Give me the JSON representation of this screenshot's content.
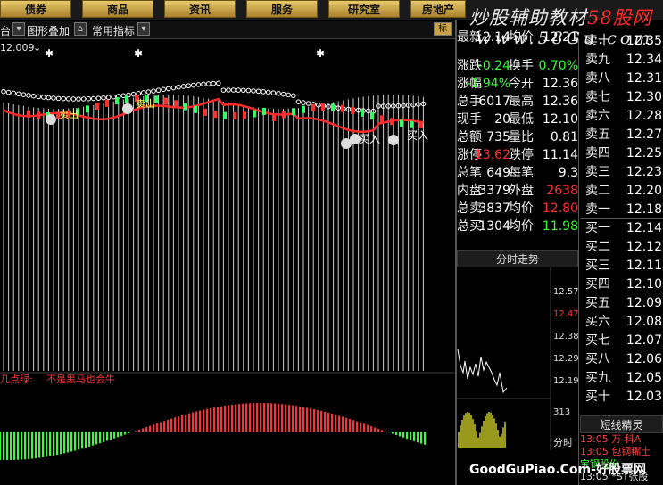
{
  "tabs": [
    "债券",
    "商品",
    "资讯",
    "服务",
    "研究室",
    "房地产"
  ],
  "toolbar": {
    "cut_left": "台",
    "overlay_label": "图形叠加",
    "indicator_label": "常用指标",
    "right_label": "标"
  },
  "watermark": {
    "line1_a": "炒股辅助教材",
    "line1_b": "58股网",
    "line2": "www.58Gu.com"
  },
  "main": {
    "price_label": "12.009",
    "signal_text_cut": "几点绿:",
    "signal_text": "不是黑马也会牛",
    "buy_label": "买入",
    "sell_label": "卖出"
  },
  "quote": [
    {
      "l": "最新",
      "v": "12.14",
      "l2": "均价",
      "v2": "12.21"
    },
    {
      "l": "涨跌",
      "v": "-0.24",
      "l2": "换手",
      "v2": "0.70%"
    },
    {
      "l": "涨幅",
      "v": "-1.94%",
      "l2": "今开",
      "v2": "12.36"
    },
    {
      "l": "总手",
      "v": "6017",
      "l2": "最高",
      "v2": "12.36"
    },
    {
      "l": "现手",
      "v": "20",
      "l2": "最低",
      "v2": "12.10"
    },
    {
      "l": "总额",
      "v": "735",
      "l2": "量比",
      "v2": "0.81"
    },
    {
      "l": "涨停",
      "v": "13.62",
      "l2": "跌停",
      "v2": "11.14"
    },
    {
      "l": "总笔",
      "v": "649",
      "l2": "每笔",
      "v2": "9.3"
    },
    {
      "l": "内盘",
      "v": "3379",
      "l2": "外盘",
      "v2": "2638"
    },
    {
      "l": "总卖",
      "v": "3837",
      "l2": "均价",
      "v2": "12.80"
    },
    {
      "l": "总买",
      "v": "1304",
      "l2": "均价",
      "v2": "11.98"
    }
  ],
  "book": {
    "sell": [
      {
        "l": "卖十",
        "v": "12.35"
      },
      {
        "l": "卖九",
        "v": "12.34"
      },
      {
        "l": "卖八",
        "v": "12.31"
      },
      {
        "l": "卖七",
        "v": "12.30"
      },
      {
        "l": "卖六",
        "v": "12.28"
      },
      {
        "l": "卖五",
        "v": "12.27"
      },
      {
        "l": "卖四",
        "v": "12.25"
      },
      {
        "l": "卖三",
        "v": "12.23"
      },
      {
        "l": "卖二",
        "v": "12.20"
      },
      {
        "l": "卖一",
        "v": "12.18"
      }
    ],
    "buy": [
      {
        "l": "买一",
        "v": "12.14"
      },
      {
        "l": "买二",
        "v": "12.12"
      },
      {
        "l": "买三",
        "v": "12.11"
      },
      {
        "l": "买四",
        "v": "12.10"
      },
      {
        "l": "买五",
        "v": "12.09"
      },
      {
        "l": "买六",
        "v": "12.08"
      },
      {
        "l": "买七",
        "v": "12.07"
      },
      {
        "l": "买八",
        "v": "12.06"
      },
      {
        "l": "买九",
        "v": "12.05"
      },
      {
        "l": "买十",
        "v": "12.03"
      }
    ]
  },
  "intraday": {
    "title": "分时走势",
    "axis": [
      "12.57",
      "12.47",
      "12.38",
      "12.29",
      "12.19"
    ],
    "vol_label": "313",
    "time_label": "分时"
  },
  "short_wizard": {
    "title": "短线精灵",
    "rows": [
      "13:05 万  科A",
      "13:05 包钢稀土",
      "宝钢股份",
      "13:05 *ST张股"
    ]
  },
  "bottom_watermark": "GoodGuPiao.Com-好股票网",
  "colors": {
    "up": "#ff3030",
    "down": "#33ff33",
    "neutral": "#ffffff",
    "yellow": "#ffff33",
    "tab": "#c9a24a"
  }
}
